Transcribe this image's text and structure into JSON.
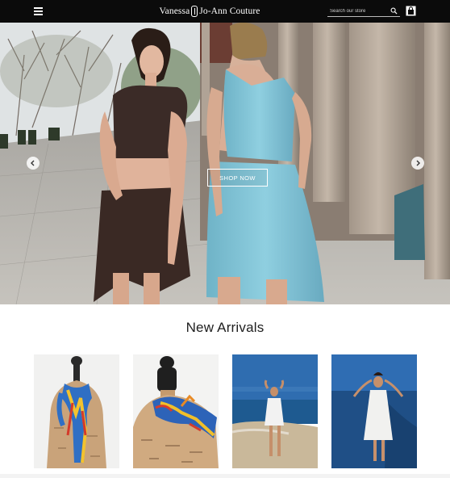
{
  "header": {
    "brand_left": "Vanessa",
    "brand_right": "Jo-Ann Couture",
    "search_placeholder": "Search our store",
    "icons": [
      "hamburger-menu-icon",
      "search-icon",
      "shopping-bag-icon"
    ]
  },
  "hero": {
    "cta_label": "SHOP NOW",
    "icons": [
      "chevron-left-icon",
      "chevron-right-icon"
    ]
  },
  "new_arrivals": {
    "title": "New Arrivals",
    "products": [
      {
        "image": "scarf-on-mannequin"
      },
      {
        "image": "scarf-tied-on-mannequin-neck"
      },
      {
        "image": "model-on-beach-white-dress"
      },
      {
        "image": "model-by-sea-white-dress"
      }
    ]
  },
  "colors": {
    "header_bg": "#0b0b0b",
    "text_dark": "#1e1e1e",
    "dress_blue": "#7cc0d3",
    "dress_brown": "#3b2b27"
  }
}
